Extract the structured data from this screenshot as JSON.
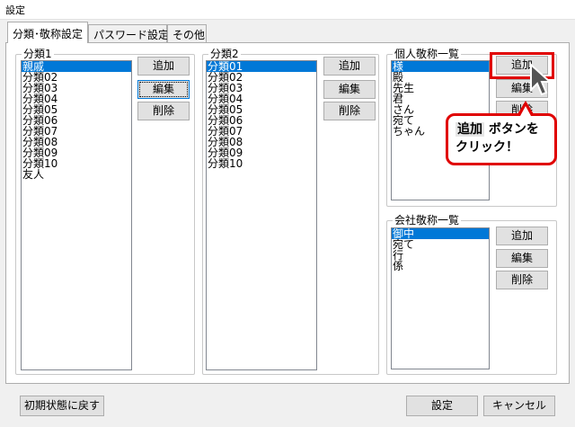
{
  "window": {
    "title": "設定"
  },
  "tabs": [
    {
      "label": "分類･敬称設定"
    },
    {
      "label": "パスワード設定"
    },
    {
      "label": "その他"
    }
  ],
  "group1": {
    "label": "分類1",
    "items": [
      "親戚",
      "分類02",
      "分類03",
      "分類04",
      "分類05",
      "分類06",
      "分類07",
      "分類08",
      "分類09",
      "分類10",
      "友人"
    ],
    "selected_index": 0,
    "add": "追加",
    "edit": "編集",
    "delete": "削除"
  },
  "group2": {
    "label": "分類2",
    "items": [
      "分類01",
      "分類02",
      "分類03",
      "分類04",
      "分類05",
      "分類06",
      "分類07",
      "分類08",
      "分類09",
      "分類10"
    ],
    "selected_index": 0,
    "add": "追加",
    "edit": "編集",
    "delete": "削除"
  },
  "personal": {
    "label": "個人敬称一覧",
    "items": [
      "様",
      "殿",
      "先生",
      "君",
      "さん",
      "宛て",
      "ちゃん"
    ],
    "selected_index": 0,
    "add": "追加",
    "edit": "編集",
    "delete": "削除"
  },
  "company": {
    "label": "会社敬称一覧",
    "items": [
      "御中",
      "宛て",
      "行",
      "係"
    ],
    "selected_index": 0,
    "add": "追加",
    "edit": "編集",
    "delete": "削除"
  },
  "callout": {
    "highlight": "追加",
    "line1_rest": " ボタンを",
    "line2": "クリック！"
  },
  "footer": {
    "reset": "初期状態に戻す",
    "ok": "設定",
    "cancel": "キャンセル"
  },
  "colors": {
    "selection": "#0078d7",
    "annotation": "#e00000"
  }
}
